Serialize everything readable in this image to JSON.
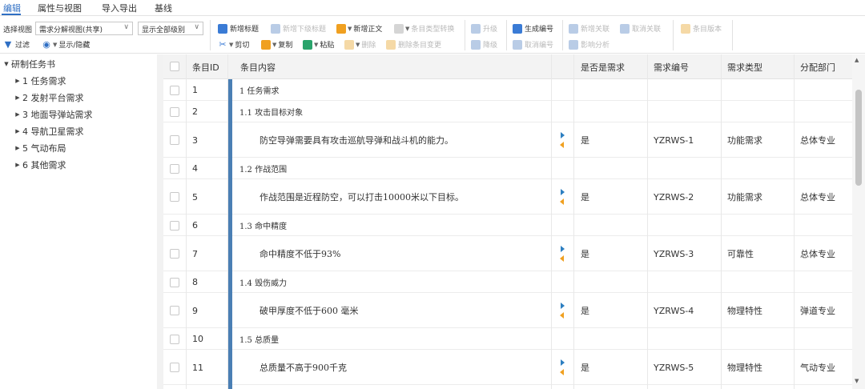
{
  "menu": {
    "tabs": [
      {
        "label": "编辑",
        "active": true
      },
      {
        "label": "属性与视图",
        "active": false
      },
      {
        "label": "导入导出",
        "active": false
      },
      {
        "label": "基线",
        "active": false
      }
    ]
  },
  "toolbar": {
    "select_view_label": "选择视图",
    "view_value": "需求分解视图(共享)",
    "level_value": "显示全部级别",
    "filter_label": "过滤",
    "show_hide_label": "显示/隐藏",
    "buttons": {
      "new_heading": "新增标题",
      "new_sub_heading": "新增下级标题",
      "new_body": "新增正文",
      "type_convert": "条目类型转换",
      "promote": "升级",
      "generate_id": "生成编号",
      "new_link": "新增关联",
      "cancel_link": "取消关联",
      "item_version": "条目版本",
      "cut": "剪切",
      "copy": "复制",
      "paste": "粘贴",
      "delete": "删除",
      "delete_change": "删除条目变更",
      "demote": "降级",
      "cancel_id": "取消编号",
      "impact_analysis": "影响分析"
    }
  },
  "tree": {
    "root": "研制任务书",
    "children": [
      "1 任务需求",
      "2 发射平台需求",
      "3 地面导弹站需求",
      "4 导航卫星需求",
      "5 气动布局",
      "6 其他需求"
    ]
  },
  "grid": {
    "headers": {
      "id": "条目ID",
      "content": "条目内容",
      "is_req": "是否是需求",
      "req_no": "需求编号",
      "req_type": "需求类型",
      "dept": "分配部门"
    },
    "rows": [
      {
        "id": "1",
        "content": "1 任务需求",
        "kind": "heading",
        "is_req": "",
        "req_no": "",
        "req_type": "",
        "dept": ""
      },
      {
        "id": "2",
        "content": "1.1 攻击目标对象",
        "kind": "heading",
        "is_req": "",
        "req_no": "",
        "req_type": "",
        "dept": ""
      },
      {
        "id": "3",
        "content": "防空导弹需要具有攻击巡航导弹和战斗机的能力。",
        "kind": "body",
        "is_req": "是",
        "req_no": "YZRWS-1",
        "req_type": "功能需求",
        "dept": "总体专业"
      },
      {
        "id": "4",
        "content": "1.2 作战范围",
        "kind": "heading",
        "is_req": "",
        "req_no": "",
        "req_type": "",
        "dept": ""
      },
      {
        "id": "5",
        "content": "作战范围是近程防空，可以打击10000米以下目标。",
        "kind": "body",
        "is_req": "是",
        "req_no": "YZRWS-2",
        "req_type": "功能需求",
        "dept": "总体专业"
      },
      {
        "id": "6",
        "content": "1.3 命中精度",
        "kind": "heading",
        "is_req": "",
        "req_no": "",
        "req_type": "",
        "dept": ""
      },
      {
        "id": "7",
        "content": "命中精度不低于93%",
        "kind": "body",
        "is_req": "是",
        "req_no": "YZRWS-3",
        "req_type": "可靠性",
        "dept": "总体专业"
      },
      {
        "id": "8",
        "content": "1.4 毁伤威力",
        "kind": "heading",
        "is_req": "",
        "req_no": "",
        "req_type": "",
        "dept": ""
      },
      {
        "id": "9",
        "content": "破甲厚度不低于600 毫米",
        "kind": "body",
        "is_req": "是",
        "req_no": "YZRWS-4",
        "req_type": "物理特性",
        "dept": "弹道专业"
      },
      {
        "id": "10",
        "content": "1.5 总质量",
        "kind": "heading",
        "is_req": "",
        "req_no": "",
        "req_type": "",
        "dept": ""
      },
      {
        "id": "11",
        "content": "总质量不高于900千克",
        "kind": "body",
        "is_req": "是",
        "req_no": "YZRWS-5",
        "req_type": "物理特性",
        "dept": "气动专业"
      }
    ]
  },
  "colors": {
    "accent": "#2f6fc4",
    "content_bar": "#4a7fb4",
    "arrow_right": "#2d7fc1",
    "arrow_left": "#f0a020"
  }
}
